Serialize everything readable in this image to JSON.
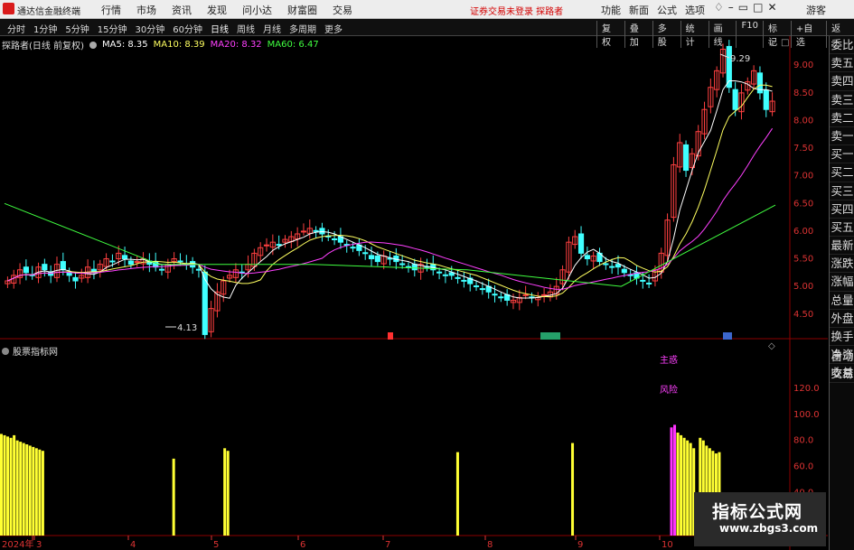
{
  "app": {
    "title": "通达信金融终端",
    "menus": [
      "行情",
      "市场",
      "资讯",
      "发现",
      "问小达",
      "财富圈",
      "交易"
    ],
    "warning": "证券交易未登录  探路者",
    "right_menus": [
      "功能",
      "新面",
      "公式",
      "选项"
    ],
    "guest": "游客"
  },
  "toolbar": {
    "periods": [
      "分时",
      "1分钟",
      "5分钟",
      "15分钟",
      "30分钟",
      "60分钟",
      "日线",
      "周线",
      "月线",
      "多周期",
      "更多"
    ],
    "active": "日线",
    "tools": [
      "复权",
      "叠加",
      "多股",
      "统计",
      "画线",
      "F10",
      "标记",
      "+自选",
      "返回"
    ]
  },
  "legend": {
    "name": "探路者(日线 前复权)",
    "ma5": "MA5: 8.35",
    "ma10": "MA10: 8.39",
    "ma20": "MA20: 8.32",
    "ma60": "MA60: 6.47"
  },
  "colors": {
    "up": "#ff4040",
    "down": "#40ffff",
    "ma5": "#ffffff",
    "ma10": "#ffff60",
    "ma20": "#ff40ff",
    "ma60": "#40ff40",
    "bar": "#ffff33",
    "bar_magenta": "#ff33ff"
  },
  "yaxis_main": [
    "9.00",
    "8.50",
    "8.00",
    "7.50",
    "7.00",
    "6.50",
    "6.00",
    "5.50",
    "5.00",
    "4.50"
  ],
  "yaxis_sub": [
    "120.0",
    "100.0",
    "80.0",
    "60.0",
    "40.0",
    "20.0"
  ],
  "xaxis": [
    "2024年",
    "3",
    "4",
    "5",
    "6",
    "7",
    "8",
    "9",
    "10"
  ],
  "annotations": {
    "high": "9.29",
    "low": "4.13",
    "sub1": "主惑",
    "sub2": "风险"
  },
  "event_markers": [
    "",
    ""
  ],
  "subchart_title": "股票指标网",
  "side_panel": [
    "委比",
    "卖五",
    "卖四",
    "卖三",
    "卖二",
    "卖一",
    "买一",
    "买二",
    "买三",
    "买四",
    "买五",
    "最新",
    "涨跌",
    "涨幅",
    "总量",
    "外盘",
    "换手",
    "净资",
    "收益"
  ],
  "auto_trade": [
    "自动",
    "交易"
  ],
  "watermark": {
    "title": "指标公式网",
    "url": "www.zbgs3.com"
  },
  "chart_data": {
    "type": "candlestick",
    "prices": [
      5.1,
      5.2,
      5.3,
      5.25,
      5.2,
      5.35,
      5.3,
      5.2,
      5.4,
      5.3,
      5.2,
      5.1,
      5.2,
      5.35,
      5.25,
      5.4,
      5.5,
      5.45,
      5.6,
      5.5,
      5.4,
      5.45,
      5.5,
      5.4,
      5.35,
      5.3,
      5.4,
      5.5,
      5.45,
      5.4,
      5.35,
      5.3,
      4.13,
      4.6,
      4.9,
      5.1,
      5.2,
      5.3,
      5.25,
      5.4,
      5.6,
      5.7,
      5.75,
      5.8,
      5.75,
      5.85,
      5.9,
      5.95,
      6.0,
      6.05,
      6.0,
      5.95,
      5.9,
      5.85,
      5.8,
      5.75,
      5.7,
      5.65,
      5.6,
      5.5,
      5.45,
      5.55,
      5.5,
      5.45,
      5.4,
      5.35,
      5.3,
      5.4,
      5.35,
      5.3,
      5.25,
      5.2,
      5.2,
      5.15,
      5.1,
      5.05,
      5.0,
      4.95,
      4.9,
      4.85,
      4.8,
      4.75,
      4.75,
      4.8,
      4.85,
      4.8,
      4.8,
      4.85,
      4.9,
      5.0,
      5.3,
      5.8,
      5.9,
      5.6,
      5.5,
      5.55,
      5.45,
      5.4,
      5.35,
      5.35,
      5.25,
      5.2,
      5.15,
      5.1,
      5.05,
      5.3,
      5.6,
      6.2,
      7.2,
      7.6,
      7.1,
      7.4,
      7.8,
      8.2,
      8.6,
      8.9,
      9.29,
      8.6,
      8.2,
      8.5,
      8.7,
      8.9,
      8.5,
      8.2,
      8.35
    ],
    "ma60_anchor": [
      6.5,
      5.4,
      5.4,
      5.3,
      5.0,
      6.47
    ],
    "indicator": [
      85,
      84,
      83,
      82,
      84,
      80,
      79,
      78,
      77,
      76,
      75,
      74,
      73,
      72,
      0,
      0,
      0,
      0,
      0,
      0,
      0,
      0,
      0,
      0,
      0,
      0,
      0,
      0,
      0,
      0,
      0,
      0,
      0,
      0,
      0,
      0,
      0,
      0,
      0,
      0,
      0,
      0,
      0,
      0,
      0,
      0,
      0,
      0,
      0,
      0,
      0,
      0,
      0,
      0,
      66,
      0,
      0,
      0,
      0,
      0,
      0,
      0,
      0,
      0,
      0,
      0,
      0,
      0,
      0,
      0,
      74,
      72,
      0,
      0,
      0,
      0,
      0,
      0,
      0,
      0,
      0,
      0,
      0,
      0,
      0,
      0,
      0,
      0,
      0,
      0,
      0,
      0,
      0,
      0,
      0,
      0,
      0,
      0,
      0,
      0,
      0,
      0,
      0,
      0,
      0,
      0,
      0,
      0,
      0,
      0,
      0,
      0,
      0,
      0,
      0,
      0,
      0,
      0,
      0,
      0,
      0,
      0,
      0,
      0,
      0,
      0,
      0,
      0,
      0,
      0,
      0,
      0,
      0,
      0,
      0,
      0,
      0,
      0,
      0,
      0,
      0,
      0,
      0,
      71,
      0,
      0,
      0,
      0,
      0,
      0,
      0,
      0,
      0,
      0,
      0,
      0,
      0,
      0,
      0,
      0,
      0,
      0,
      0,
      0,
      0,
      0,
      0,
      0,
      0,
      0,
      0,
      0,
      0,
      0,
      0,
      0,
      0,
      0,
      0,
      78,
      0,
      0,
      0,
      0,
      0,
      0,
      0,
      0,
      0,
      0,
      0,
      0,
      0,
      0,
      0,
      0,
      0,
      0,
      0,
      0,
      0,
      0,
      0,
      0,
      0,
      0,
      0,
      0,
      0,
      0,
      90,
      92,
      86,
      84,
      82,
      80,
      78,
      74,
      0,
      82,
      80,
      76,
      74,
      72,
      70,
      71
    ]
  }
}
